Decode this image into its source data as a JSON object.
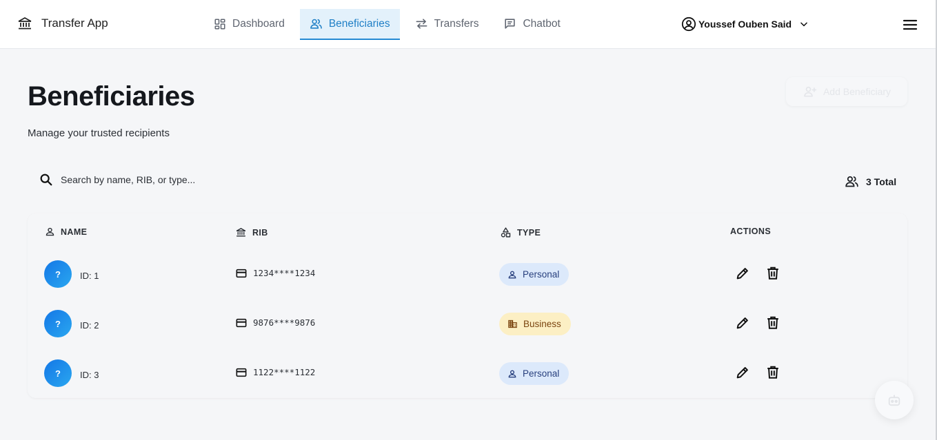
{
  "app": {
    "name": "Transfer App",
    "brand_icon": "bank-icon"
  },
  "nav": [
    {
      "label": "Dashboard",
      "icon": "dashboard-icon",
      "active": false
    },
    {
      "label": "Beneficiaries",
      "icon": "users-icon",
      "active": true
    },
    {
      "label": "Transfers",
      "icon": "transfer-arrows-icon",
      "active": false
    },
    {
      "label": "Chatbot",
      "icon": "chat-icon",
      "active": false
    }
  ],
  "user": {
    "name": "Youssef Ouben Said"
  },
  "page": {
    "title": "Beneficiaries",
    "subtitle": "Manage your trusted recipients",
    "add_button_label": "Add Beneficiary"
  },
  "search": {
    "placeholder": "Search by name, RIB, or type...",
    "value": ""
  },
  "summary": {
    "total_label": "3 Total"
  },
  "table": {
    "headers": {
      "name": "NAME",
      "rib": "RIB",
      "type": "TYPE",
      "actions": "ACTIONS"
    },
    "rows": [
      {
        "avatar": "?",
        "id_label": "ID: 1",
        "rib": "1234****1234",
        "type": "Personal"
      },
      {
        "avatar": "?",
        "id_label": "ID: 2",
        "rib": "9876****9876",
        "type": "Business"
      },
      {
        "avatar": "?",
        "id_label": "ID: 3",
        "rib": "1122****1122",
        "type": "Personal"
      }
    ]
  },
  "colors": {
    "accent": "#2389d3",
    "active_tab_bg": "#e3f1fb",
    "personal_badge_bg": "#dce9fb",
    "business_badge_bg": "#fcefc4",
    "avatar_gradient_start": "#1477e6",
    "avatar_gradient_end": "#2aa7f0"
  }
}
